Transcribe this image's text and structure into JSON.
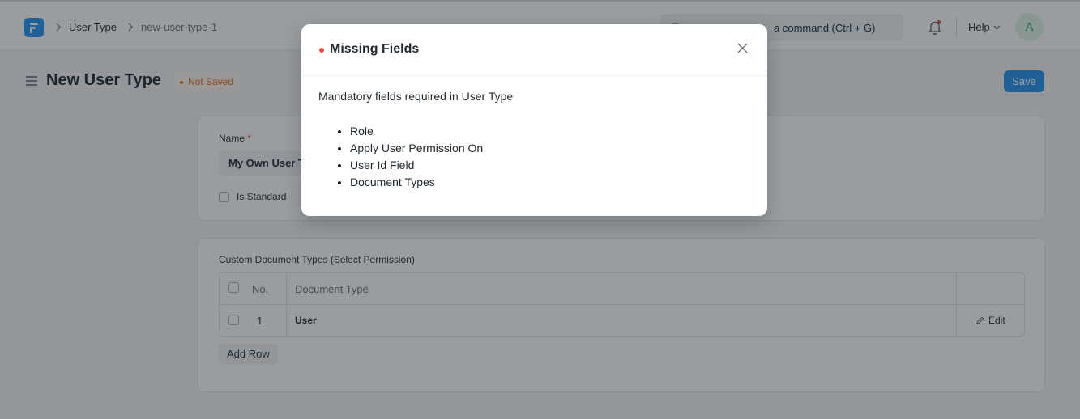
{
  "navbar": {
    "breadcrumbs": [
      "User Type",
      "new-user-type-1"
    ],
    "search": {
      "placeholder": "Search or type a command (Ctrl + G)",
      "visible_text": "a command (Ctrl + G)"
    },
    "help_label": "Help",
    "avatar_initial": "A",
    "icons": [
      "app-logo",
      "chevron-right-icon",
      "search-icon",
      "bell-icon",
      "chevron-down-icon"
    ]
  },
  "page": {
    "title": "New User Type",
    "status": "Not Saved",
    "save_label": "Save"
  },
  "form": {
    "name_label": "Name",
    "required_mark": "*",
    "name_value": "My Own User Type",
    "is_standard_label": "Is Standard"
  },
  "doc_types": {
    "label": "Custom Document Types (Select Permission)",
    "columns": {
      "no": "No.",
      "document_type": "Document Type"
    },
    "rows": [
      {
        "no": "1",
        "document_type": "User",
        "edit_label": "Edit"
      }
    ],
    "add_row_label": "Add Row"
  },
  "modal": {
    "title": "Missing Fields",
    "message": "Mandatory fields required in User Type",
    "fields": [
      "Role",
      "Apply User Permission On",
      "User Id Field",
      "Document Types"
    ]
  },
  "colors": {
    "primary": "#2490ef",
    "status_orange": "#e86c13",
    "indicator_red": "#e24c4c",
    "avatar_green": "#38a169"
  }
}
